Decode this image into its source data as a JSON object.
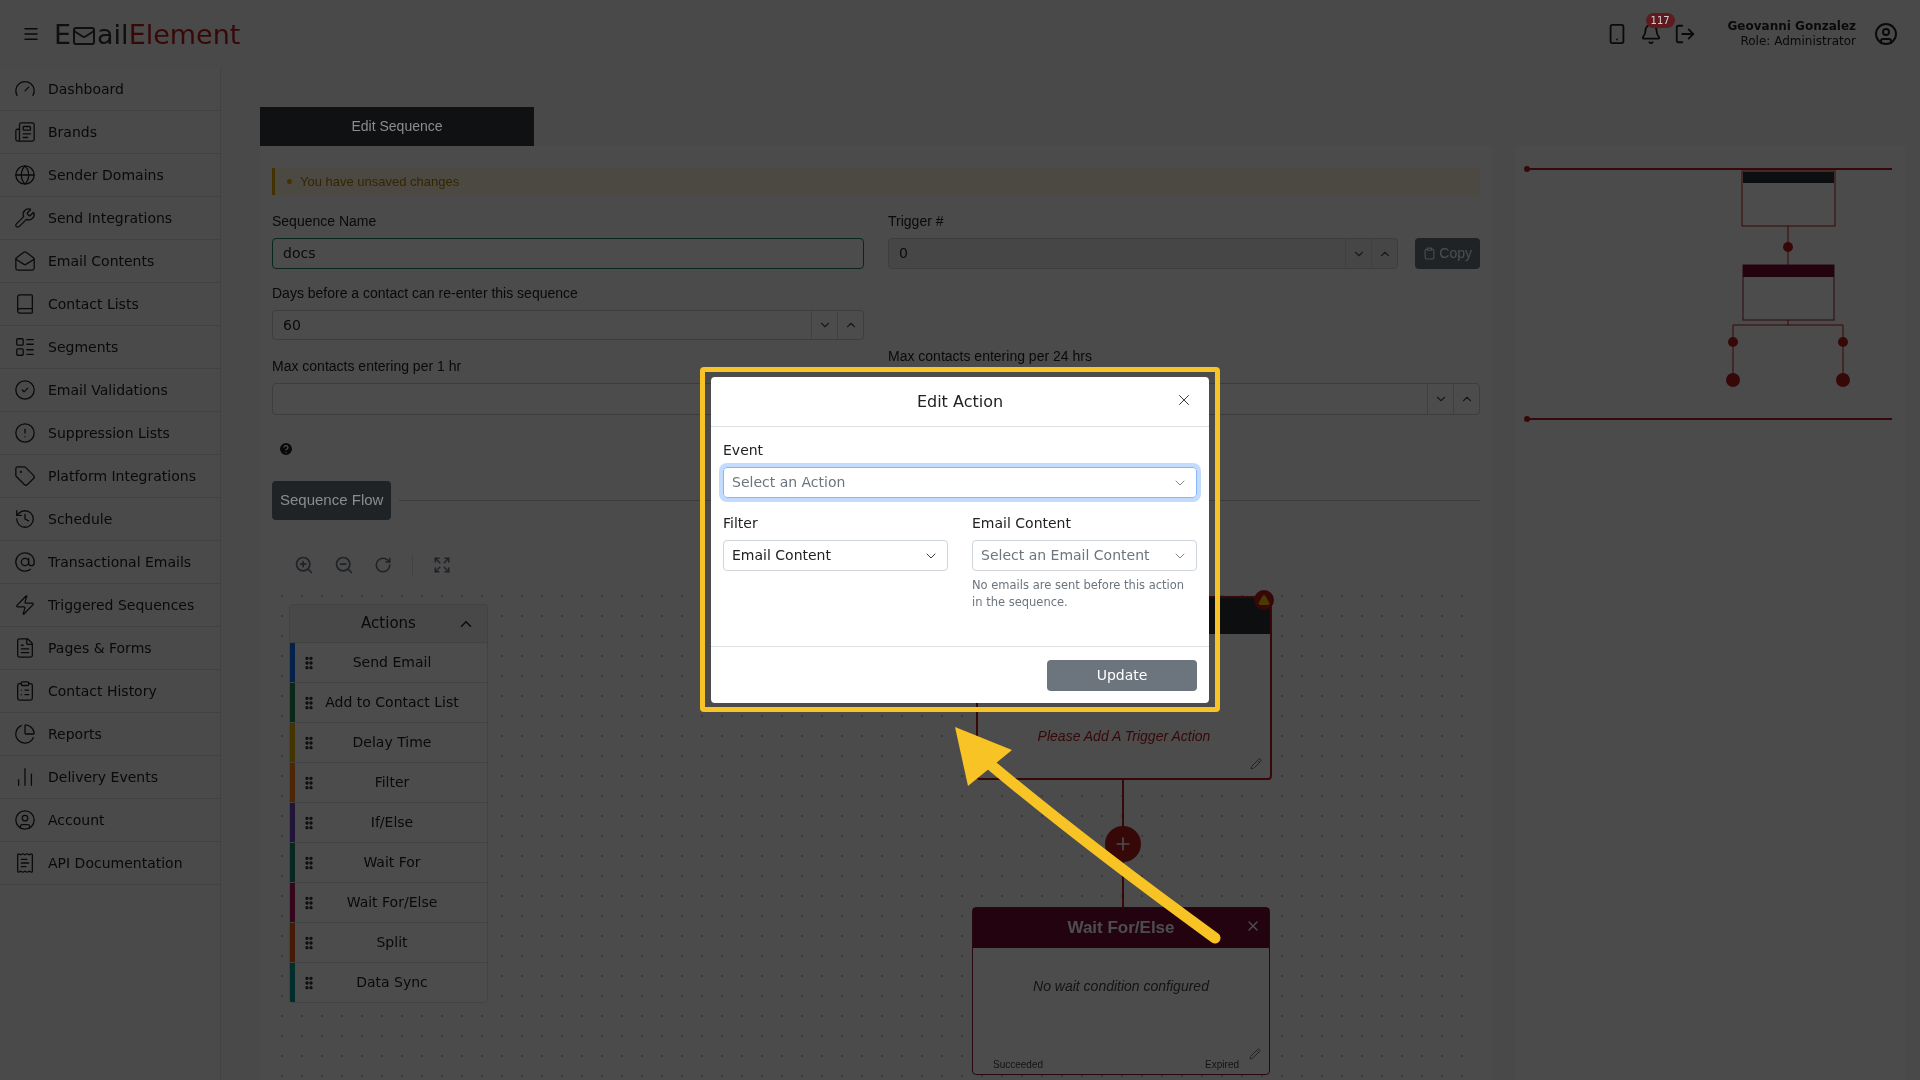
{
  "header": {
    "logo": {
      "initial": "E",
      "middle": "ail",
      "accent": "Element"
    },
    "notification_count": "117",
    "user": {
      "name": "Geovanni Gonzalez",
      "role": "Role: Administrator"
    }
  },
  "sidebar": {
    "items": [
      {
        "label": "Dashboard"
      },
      {
        "label": "Brands"
      },
      {
        "label": "Sender Domains"
      },
      {
        "label": "Send Integrations"
      },
      {
        "label": "Email Contents"
      },
      {
        "label": "Contact Lists"
      },
      {
        "label": "Segments"
      },
      {
        "label": "Email Validations"
      },
      {
        "label": "Suppression Lists"
      },
      {
        "label": "Platform Integrations"
      },
      {
        "label": "Schedule"
      },
      {
        "label": "Transactional Emails"
      },
      {
        "label": "Triggered Sequences"
      },
      {
        "label": "Pages & Forms"
      },
      {
        "label": "Contact History"
      },
      {
        "label": "Reports"
      },
      {
        "label": "Delivery Events"
      },
      {
        "label": "Account"
      },
      {
        "label": "API Documentation"
      }
    ]
  },
  "editor": {
    "tab": "Edit Sequence",
    "alert": "You have unsaved changes",
    "sequence_name": {
      "label": "Sequence Name",
      "value": "docs"
    },
    "trigger": {
      "label": "Trigger #",
      "value": "0",
      "button": "Copy"
    },
    "reentry_days": {
      "label": "Days before a contact can re-enter this sequence",
      "value": "60"
    },
    "max_per_hour": {
      "label": "Max contacts entering per 1 hr"
    },
    "max_per_day": {
      "label": "Max contacts entering per 24 hrs"
    },
    "flow_button": "Sequence Flow",
    "actions_panel": {
      "title": "Actions",
      "expanded": true,
      "items": [
        {
          "label": "Send Email",
          "color": "#04214c"
        },
        {
          "label": "Add to Contact List",
          "color": "#082919"
        },
        {
          "label": "Delay Time",
          "color": "#433500"
        },
        {
          "label": "Filter",
          "color": "#4c2606"
        },
        {
          "label": "If/Else",
          "color": "#21143a"
        },
        {
          "label": "Wait For",
          "color": "#052920"
        },
        {
          "label": "Wait For/Else",
          "color": "#35061b"
        },
        {
          "label": "Split",
          "color": "#461b04"
        },
        {
          "label": "Data Sync",
          "color": "#032c2d"
        }
      ]
    },
    "nodes": [
      {
        "kind": "trigger",
        "message": "Please Add A Trigger Action",
        "warning": true
      },
      {
        "kind": "wait_for_else",
        "title": "Wait For/Else",
        "message": "No wait condition configured",
        "outcomes": [
          "Succeeded",
          "Expired"
        ]
      }
    ]
  },
  "modal": {
    "title": "Edit Action",
    "event": {
      "label": "Event",
      "placeholder": "Select an Action",
      "focused": true
    },
    "filter": {
      "label": "Filter",
      "value": "Email Content"
    },
    "email_content": {
      "label": "Email Content",
      "placeholder": "Select an Email Content",
      "help": "No emails are sent before this action in the sequence."
    },
    "button": "Update"
  }
}
